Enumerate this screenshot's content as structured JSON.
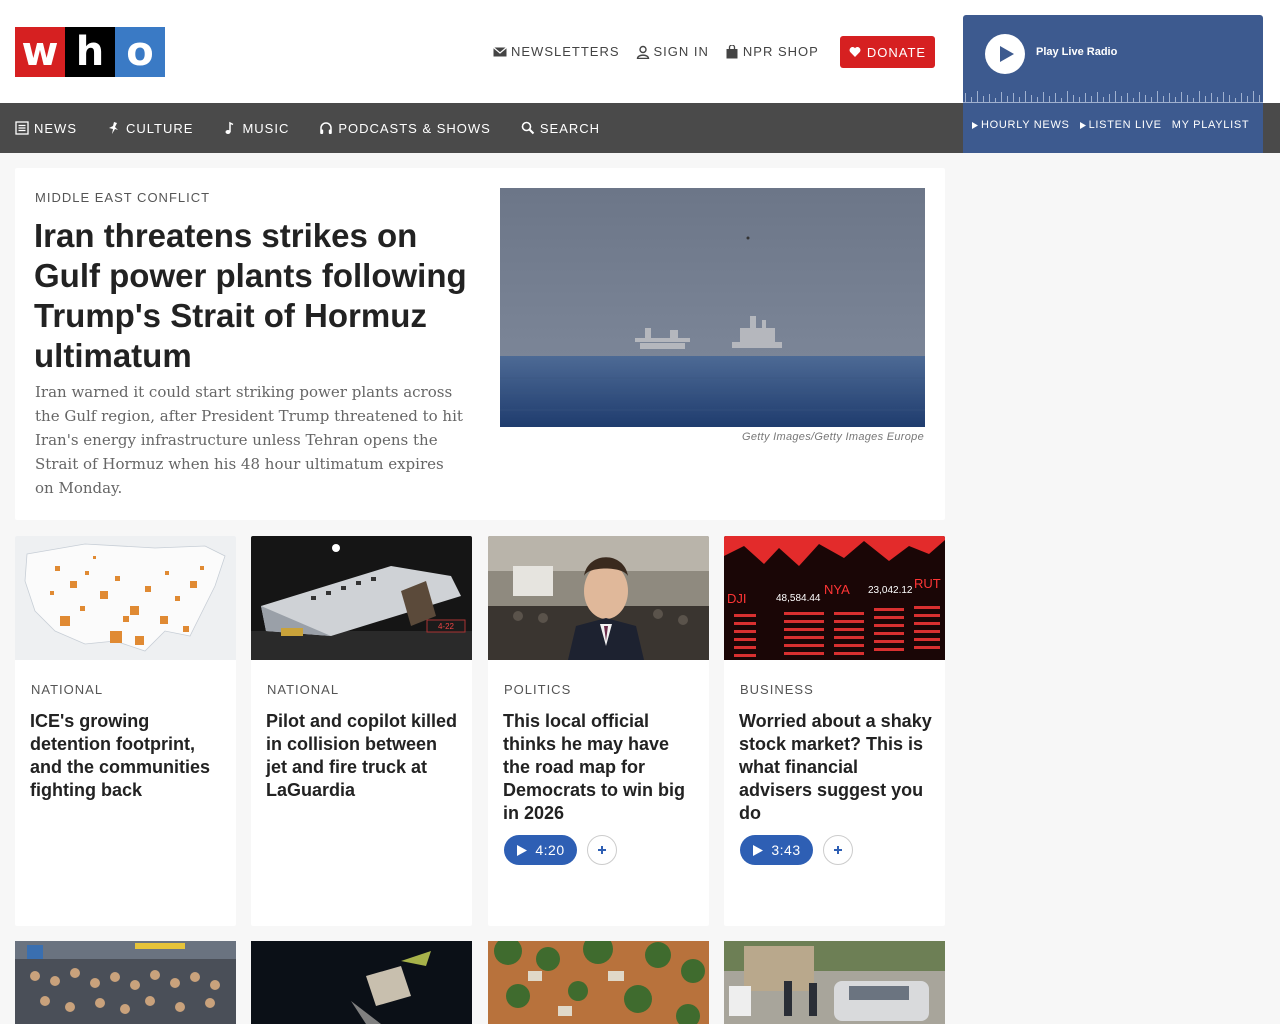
{
  "logo": {
    "letters": [
      "w",
      "h",
      "o"
    ]
  },
  "utility": {
    "newsletters": "NEWSLETTERS",
    "sign_in": "SIGN IN",
    "shop": "NPR SHOP",
    "donate": "DONATE"
  },
  "nav": {
    "items": [
      {
        "label": "NEWS",
        "icon": "news-icon"
      },
      {
        "label": "CULTURE",
        "icon": "culture-icon"
      },
      {
        "label": "MUSIC",
        "icon": "music-note-icon"
      },
      {
        "label": "PODCASTS & SHOWS",
        "icon": "headphones-icon"
      },
      {
        "label": "SEARCH",
        "icon": "search-icon"
      }
    ]
  },
  "player": {
    "label": "Play Live Radio",
    "links": [
      "HOURLY NEWS",
      "LISTEN LIVE",
      "MY PLAYLIST"
    ]
  },
  "featured": {
    "category": "MIDDLE EAST CONFLICT",
    "title": "Iran threatens strikes on Gulf power plants following Trump's Strait of Hormuz ultimatum",
    "teaser": "Iran warned it could start striking power plants across the Gulf region, after President Trump threatened to hit Iran's energy infrastructure unless Tehran opens the Strait of Hormuz when his 48 hour ultimatum expires on Monday.",
    "credit": "Getty Images/Getty Images Europe"
  },
  "cards": [
    {
      "category": "NATIONAL",
      "title": "ICE's growing detention footprint, and the communities fighting back"
    },
    {
      "category": "NATIONAL",
      "title": "Pilot and copilot killed in collision between jet and fire truck at LaGuardia"
    },
    {
      "category": "POLITICS",
      "title": "This local official thinks he may have the road map for Democrats to win big in 2026",
      "duration": "4:20"
    },
    {
      "category": "BUSINESS",
      "title": "Worried about a shaky stock market? This is what financial advisers suggest you do",
      "duration": "3:43"
    }
  ],
  "thumb_text": {
    "plane_badge": "4-22",
    "dji": "DJI",
    "dji_value": "48,584.44",
    "nya": "NYA",
    "nya_value": "23,042.12",
    "rut": "RUT"
  },
  "colors": {
    "brand_red": "#d62021",
    "brand_blue": "#3a7ac5",
    "nav_bg": "#4a4a4a",
    "player_bg": "#3d5a8f",
    "audio_blue": "#2e5fb4"
  }
}
